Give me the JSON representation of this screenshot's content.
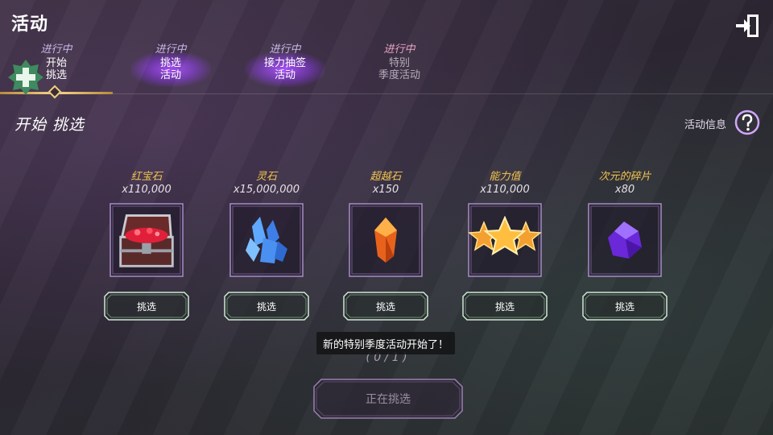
{
  "header": {
    "title": "活动"
  },
  "tabs": [
    {
      "status": "进行中",
      "line1": "开始",
      "line2": "挑选"
    },
    {
      "status": "进行中",
      "line1": "挑选",
      "line2": "活动"
    },
    {
      "status": "进行中",
      "line1": "接力抽签",
      "line2": "活动"
    },
    {
      "status": "进行中",
      "line1": "特别",
      "line2": "季度活动"
    }
  ],
  "section": {
    "title": "开始 挑选",
    "info_label": "活动信息"
  },
  "rewards": [
    {
      "name": "红宝石",
      "qty": "x110,000",
      "icon": "treasure-chest-icon",
      "pick_label": "挑选"
    },
    {
      "name": "灵石",
      "qty": "x15,000,000",
      "icon": "blue-crystal-icon",
      "pick_label": "挑选"
    },
    {
      "name": "超越石",
      "qty": "x150",
      "icon": "orange-gem-icon",
      "pick_label": "挑选"
    },
    {
      "name": "能力值",
      "qty": "x110,000",
      "icon": "gold-stars-icon",
      "pick_label": "挑选"
    },
    {
      "name": "次元的碎片",
      "qty": "x80",
      "icon": "purple-shard-icon",
      "pick_label": "挑选"
    }
  ],
  "toast": "新的特别季度活动开始了！",
  "progress": "( 0 / 1 )",
  "main_button": "正在挑选",
  "colors": {
    "accent_gold": "#f2cf7c",
    "tab_glow": "#a050ff",
    "reward_name": "#f4c64f",
    "button_border": "#cfe8d4"
  }
}
